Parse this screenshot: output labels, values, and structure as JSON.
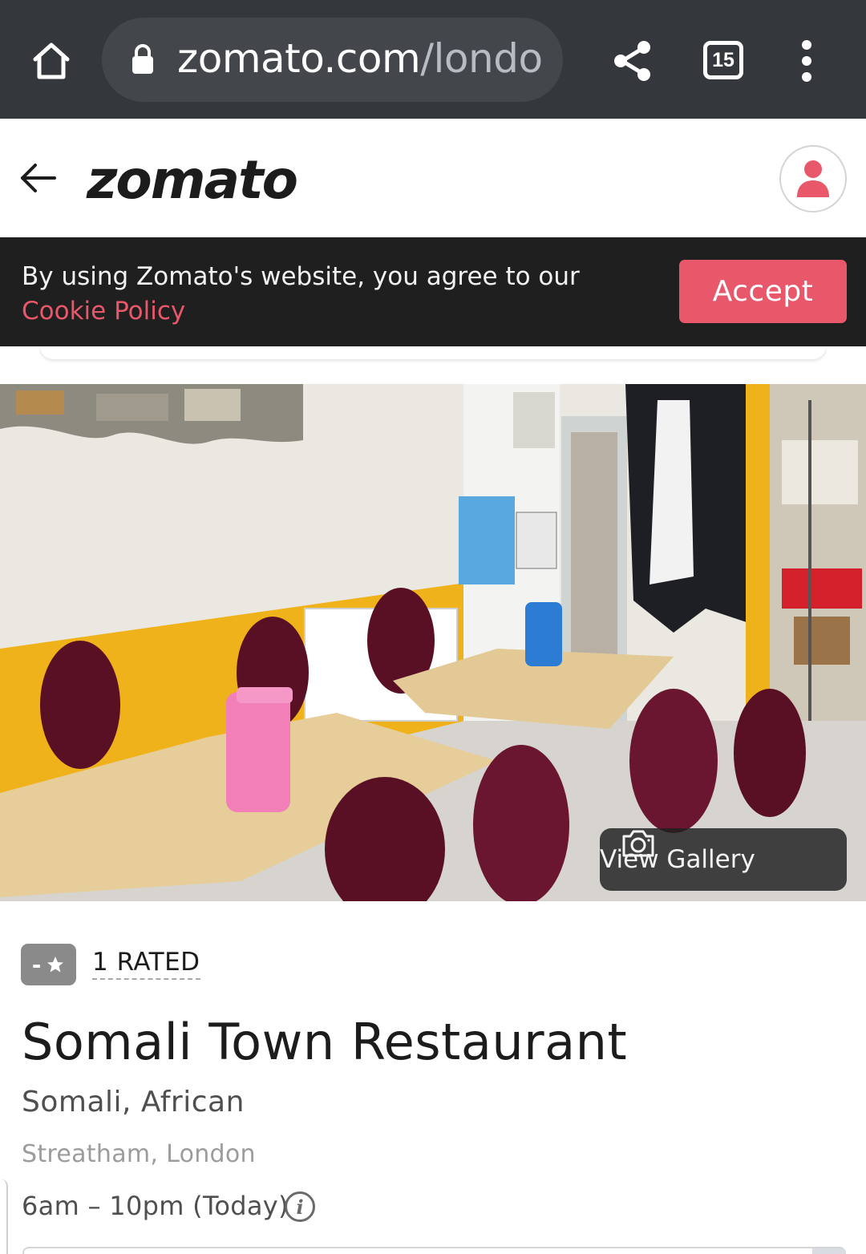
{
  "browser": {
    "url_domain": "zomato.com",
    "url_path": "/londo",
    "tab_count": "15",
    "icons": [
      "home-icon",
      "lock-icon",
      "share-icon",
      "tabs-icon",
      "more-vert-icon"
    ]
  },
  "header": {
    "logo": "zomato",
    "icons": [
      "back-arrow-icon",
      "user-icon"
    ]
  },
  "cookie": {
    "text": "By using Zomato's website, you agree to our",
    "link": "Cookie Policy",
    "accept_label": "Accept"
  },
  "hero": {
    "gallery_label": "View Gallery",
    "icons": [
      "camera-icon"
    ]
  },
  "restaurant": {
    "rating_value": "-",
    "rated_label": "1 RATED",
    "name": "Somali Town Restaurant",
    "cuisines": "Somali, African",
    "locality": "Streatham, London",
    "timings": "6am – 10pm (Today)",
    "info_glyph": "i"
  },
  "colors": {
    "browser_bar": "#34373b",
    "accent": "#e8586a",
    "banner": "#1f1f1f",
    "rating_grey": "#8a8a8a"
  }
}
